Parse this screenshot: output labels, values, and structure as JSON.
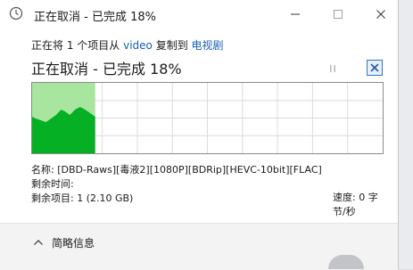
{
  "window": {
    "title": "正在取消 - 已完成 18%",
    "minimize_icon": "minimize-icon",
    "maximize_icon": "maximize-icon",
    "close_icon": "close-icon"
  },
  "copy": {
    "from_prefix": "正在将 1 个项目从 ",
    "source": "video",
    "middle": " 复制到 ",
    "destination": "电视剧",
    "status_heading": "正在取消 - 已完成 18%",
    "progress_percent": 18
  },
  "graph": {
    "speed_label": "速度: 0 字节/秒",
    "fill_color": "#06b025",
    "bg_color": "#a8e6a0"
  },
  "details": {
    "name_label": "名称: ",
    "name_value": "[DBD-Raws][毒液2][1080P][BDRip][HEVC-10bit][FLAC]",
    "time_left_label": "剩余时间:",
    "items_left_label": "剩余项目: ",
    "items_left_value": "1 (2.10 GB)"
  },
  "footer": {
    "toggle_label": "简略信息"
  }
}
